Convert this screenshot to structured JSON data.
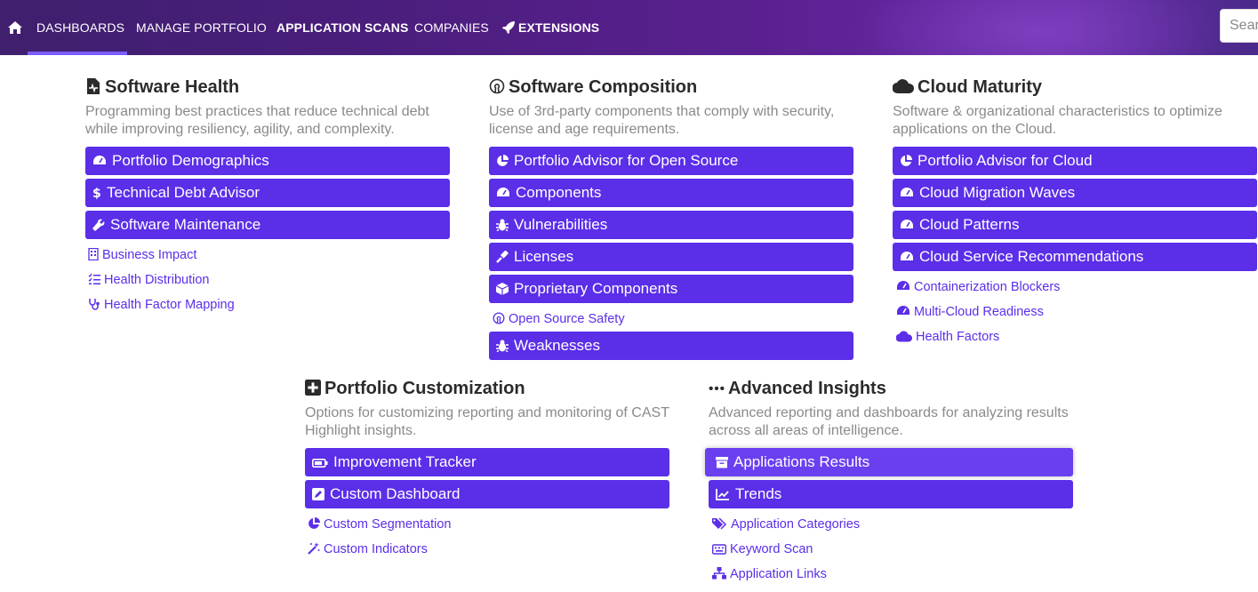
{
  "nav": {
    "items": [
      {
        "label": "DASHBOARDS"
      },
      {
        "label": "MANAGE PORTFOLIO"
      },
      {
        "label": "APPLICATION SCANS"
      },
      {
        "label": "COMPANIES"
      },
      {
        "label": "EXTENSIONS"
      }
    ],
    "search_placeholder": "Search"
  },
  "sections": {
    "health": {
      "title": "Software Health",
      "desc": "Programming best practices that reduce technical debt while improving resiliency, agility, and complexity.",
      "buttons": [
        "Portfolio Demographics",
        "Technical Debt Advisor",
        "Software Maintenance"
      ],
      "links": [
        "Business Impact",
        "Health Distribution",
        "Health Factor Mapping"
      ]
    },
    "composition": {
      "title": "Software Composition",
      "desc": "Use of 3rd-party components that comply with security, license and age requirements.",
      "buttons": [
        "Portfolio Advisor for Open Source",
        "Components",
        "Vulnerabilities",
        "Licenses",
        "Proprietary Components",
        "Weaknesses"
      ],
      "links": [
        "Open Source Safety"
      ]
    },
    "cloud": {
      "title": "Cloud Maturity",
      "desc": "Software & organizational characteristics to optimize applications on the Cloud.",
      "buttons": [
        "Portfolio Advisor for Cloud",
        "Cloud Migration Waves",
        "Cloud Patterns",
        "Cloud Service Recommendations"
      ],
      "links": [
        "Containerization Blockers",
        "Multi-Cloud Readiness",
        "Health Factors"
      ]
    },
    "customization": {
      "title": "Portfolio Customization",
      "desc": "Options for customizing reporting and monitoring of CAST Highlight insights.",
      "buttons": [
        "Improvement Tracker",
        "Custom Dashboard"
      ],
      "links": [
        "Custom Segmentation",
        "Custom Indicators"
      ]
    },
    "insights": {
      "title": "Advanced Insights",
      "desc": "Advanced reporting and dashboards for analyzing results across all areas of intelligence.",
      "buttons": [
        "Applications Results",
        "Trends"
      ],
      "links": [
        "Application Categories",
        "Keyword Scan",
        "Application Links"
      ]
    }
  },
  "colors": {
    "accent": "#5b2ee8",
    "nav_dark": "#3f1f6e",
    "nav_light": "#6a2aa8"
  }
}
